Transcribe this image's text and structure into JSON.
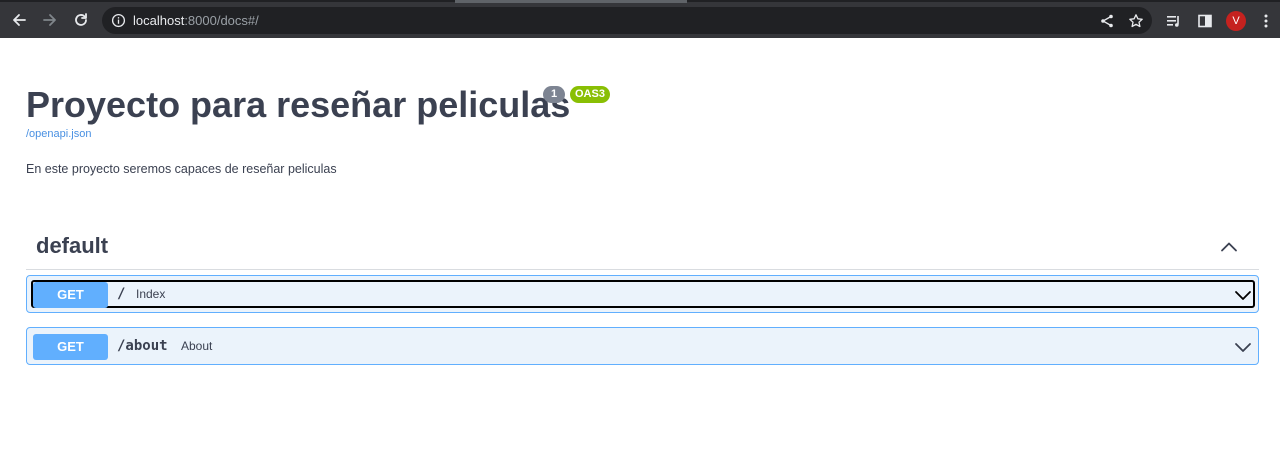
{
  "browser": {
    "url_host": "localhost",
    "url_rest": ":8000/docs#/",
    "avatar_initial": "V",
    "icons": [
      "back-arrow-icon",
      "forward-arrow-icon",
      "reload-icon",
      "info-icon",
      "share-icon",
      "star-icon",
      "media-queue-icon",
      "side-panel-icon",
      "avatar",
      "kebab-menu-icon"
    ]
  },
  "info": {
    "title": "Proyecto para reseñar peliculas",
    "version": "1",
    "oas": "OAS3",
    "spec_link": "/openapi.json",
    "description": "En este proyecto seremos capaces de reseñar peliculas"
  },
  "tag": {
    "name": "default",
    "expanded": true
  },
  "operations": [
    {
      "method": "GET",
      "path": "/",
      "summary": "Index",
      "focused": true
    },
    {
      "method": "GET",
      "path": "/about",
      "summary": "About",
      "focused": false
    }
  ],
  "colors": {
    "get_method": "#61affe",
    "get_background": "#ebf3fb",
    "oas_badge": "#89bf04",
    "version_badge": "#7d8492",
    "text": "#3b4151",
    "link": "#4990e2",
    "avatar": "#c5221f"
  }
}
